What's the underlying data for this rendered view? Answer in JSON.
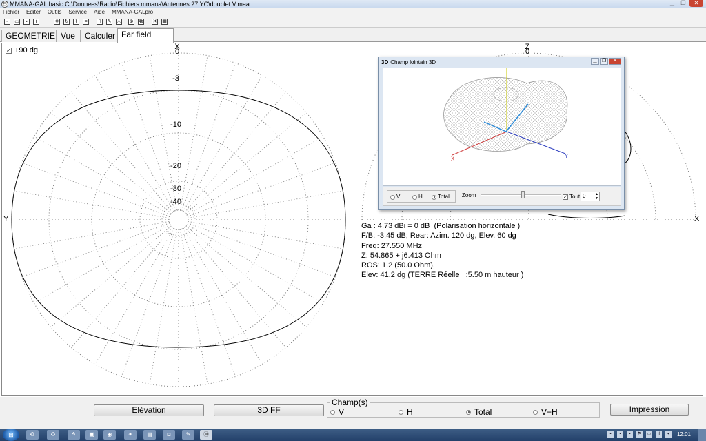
{
  "window": {
    "title": "MMANA-GAL basic C:\\Donnees\\Radio\\Fichiers mmana\\Antennes 27 YC\\doublet V.maa",
    "app_icon": "app-icon"
  },
  "menu": [
    "Fichier",
    "Editer",
    "Outils",
    "Service",
    "Aide",
    "MMANA-GALpro"
  ],
  "toolbar_icons": [
    "new-icon",
    "open-icon",
    "save-icon",
    "info-icon",
    "move-icon",
    "rotate-icon",
    "wire-icon",
    "table-icon",
    "page-icon",
    "edit-icon",
    "triangle-icon",
    "target-icon",
    "copy-icon",
    "tools-icon",
    "calc-icon"
  ],
  "tabs": [
    {
      "label": "GEOMETRIE",
      "active": false
    },
    {
      "label": "Vue",
      "active": false
    },
    {
      "label": "Calculer",
      "active": false
    },
    {
      "label": "Far field plots",
      "active": true
    }
  ],
  "plot": {
    "checkbox_label": "+90 dg",
    "checkbox_checked": true,
    "left_axis_top": "X",
    "left_axis_left": "Y",
    "right_axis_top": "Z",
    "right_axis_right": "X",
    "ring_labels": [
      "0",
      "-3",
      "-10",
      "-20",
      "-30",
      "-40"
    ],
    "right_zero": "0"
  },
  "readout": {
    "line1": "Ga : 4.73 dBi = 0 dB  (Polarisation horizontale )",
    "line2": "F/B: -3.45 dB; Rear: Azim. 120 dg, Elev. 60 dg",
    "line3": "Freq: 27.550 MHz",
    "line4": "Z: 54.865 + j6.413 Ohm",
    "line5": "ROS: 1.2 (50.0 Ohm),",
    "line6": "Elev: 41.2 dg (TERRE Réelle   :5.50 m hauteur )"
  },
  "window3d": {
    "icon_text": "3D",
    "title": "Champ lointain 3D",
    "axis_x": "X",
    "axis_y": "Y",
    "radio_v": "V",
    "radio_h": "H",
    "radio_total": "Total",
    "selected": "Total",
    "zoom_label": "Zoom",
    "zoom_level": 0.5,
    "tout_label": "Tout",
    "tout_checked": true,
    "spin_value": "0"
  },
  "bottom": {
    "elevation_button": "Elévation",
    "ff3d_button": "3D FF",
    "champ_label": "Champ(s)",
    "champ_options": [
      "V",
      "H",
      "Total",
      "V+H"
    ],
    "champ_selected": "Total",
    "print_button": "Impression"
  },
  "taskbar": {
    "clock": "12:01",
    "start_label": "⊞",
    "apps": [
      "recycle-bin-icon",
      "recycle-bin-icon",
      "flash-icon",
      "explorer-icon",
      "chrome-icon",
      "spark-icon",
      "pictures-icon",
      "camera-icon",
      "editor-icon",
      "mmana-icon"
    ]
  }
}
